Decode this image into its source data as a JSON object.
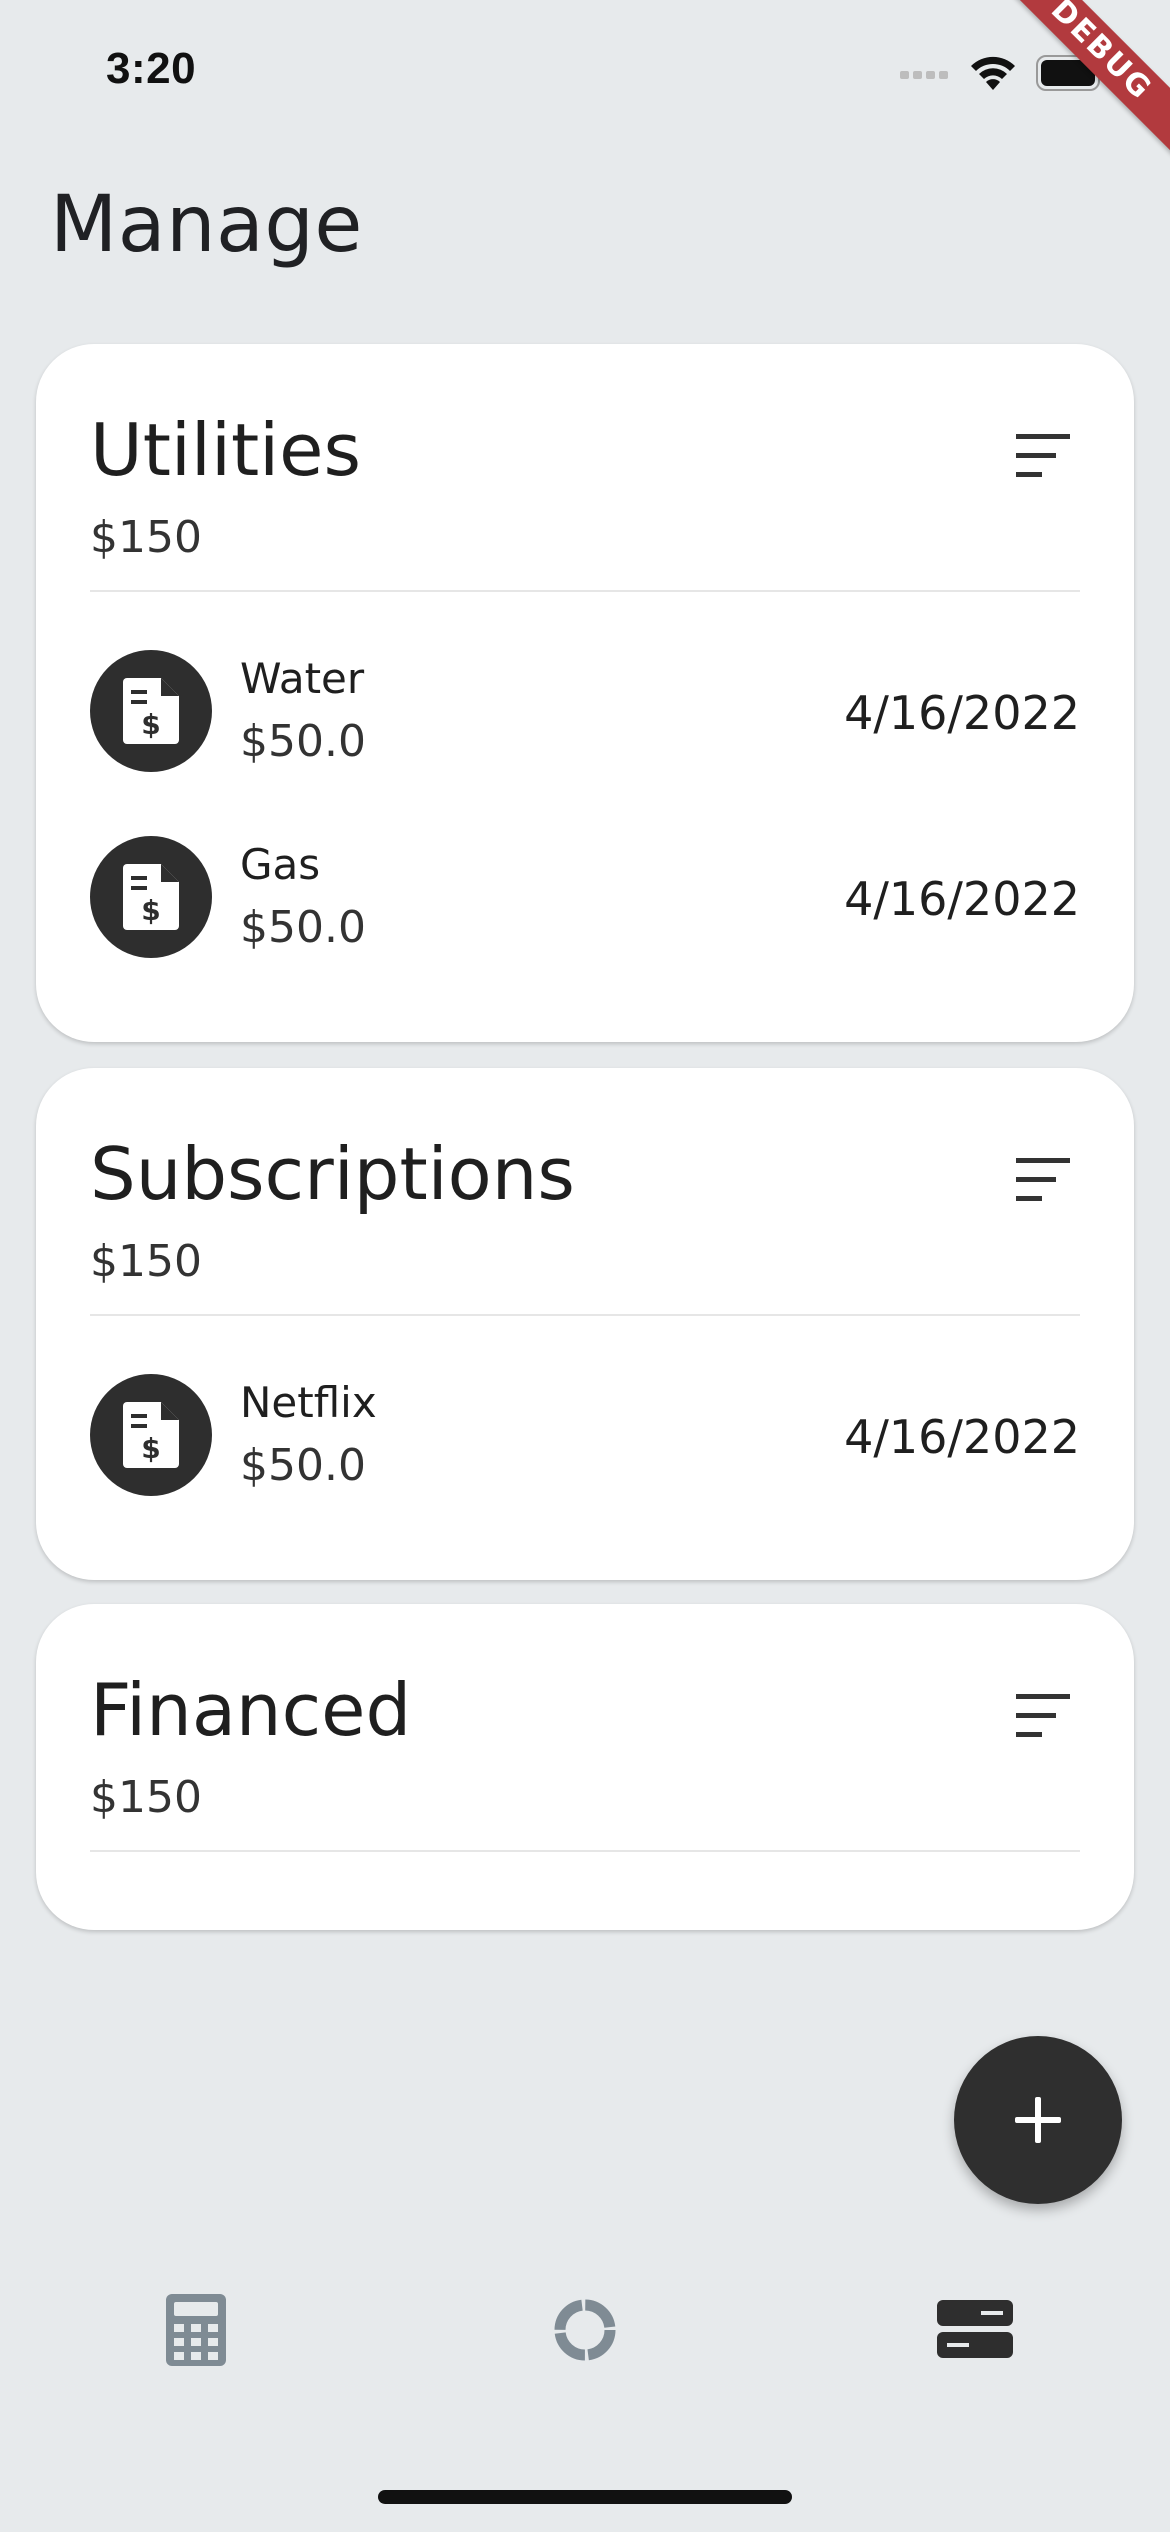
{
  "status_bar": {
    "time": "3:20",
    "icons": [
      "cellular-icon",
      "wifi-icon",
      "battery-icon"
    ]
  },
  "debug_banner": "DEBUG",
  "page_title": "Manage",
  "categories": [
    {
      "title": "Utilities",
      "total": "$150",
      "bills": [
        {
          "name": "Water",
          "amount": "$50.0",
          "date": "4/16/2022",
          "icon": "bill-icon"
        },
        {
          "name": "Gas",
          "amount": "$50.0",
          "date": "4/16/2022",
          "icon": "bill-icon"
        }
      ]
    },
    {
      "title": "Subscriptions",
      "total": "$150",
      "bills": [
        {
          "name": "Netflix",
          "amount": "$50.0",
          "date": "4/16/2022",
          "icon": "bill-icon"
        }
      ]
    },
    {
      "title": "Financed",
      "total": "$150",
      "bills": []
    }
  ],
  "fab": {
    "icon": "plus-icon"
  },
  "bottom_nav": {
    "items": [
      {
        "icon": "calculator-icon",
        "active": false
      },
      {
        "icon": "donut-chart-icon",
        "active": false
      },
      {
        "icon": "manage-list-icon",
        "active": true
      }
    ]
  },
  "colors": {
    "background": "#e7eaec",
    "card": "#ffffff",
    "dark": "#2e2e2e",
    "inactive_icon": "#7f8b94",
    "debug_banner": "#b23a3e"
  }
}
